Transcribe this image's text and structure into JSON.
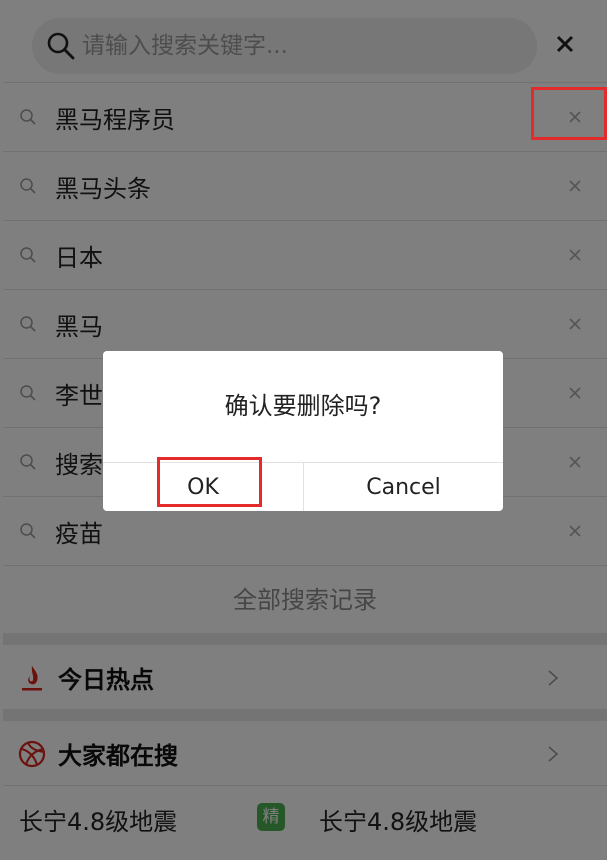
{
  "search": {
    "placeholder": "请输入搜索关键字..."
  },
  "history": {
    "items": [
      {
        "label": "黑马程序员"
      },
      {
        "label": "黑马头条"
      },
      {
        "label": "日本"
      },
      {
        "label": "黑马"
      },
      {
        "label": "李世民"
      },
      {
        "label": "搜索"
      },
      {
        "label": "疫苗"
      }
    ],
    "all_records": "全部搜索记录"
  },
  "sections": {
    "today_hot": "今日热点",
    "everyone_search": "大家都在搜"
  },
  "hot_list": {
    "row1_left": "长宁4.8级地震",
    "badge": "精",
    "row1_right": "长宁4.8级地震"
  },
  "dialog": {
    "message": "确认要删除吗?",
    "ok": "OK",
    "cancel": "Cancel"
  },
  "colors": {
    "highlight": "#e32b2b",
    "badge": "#4caf50",
    "fire": "#d6241c"
  }
}
